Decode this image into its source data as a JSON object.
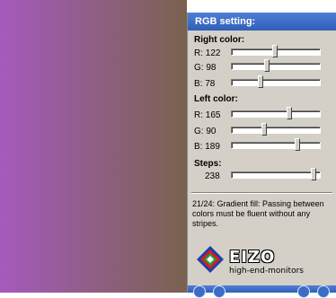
{
  "gradient": {
    "color_left": "#a55abd",
    "color_right": "#7a624e"
  },
  "panel": {
    "title": "RGB setting:",
    "right_color": {
      "label": "Right color:",
      "r": {
        "label": "R: 122",
        "value": 122
      },
      "g": {
        "label": "G: 98",
        "value": 98
      },
      "b": {
        "label": "B: 78",
        "value": 78
      }
    },
    "left_color": {
      "label": "Left color:",
      "r": {
        "label": "R: 165",
        "value": 165
      },
      "g": {
        "label": "G: 90",
        "value": 90
      },
      "b": {
        "label": "B: 189",
        "value": 189
      }
    },
    "steps": {
      "label": "Steps:",
      "value_text": "238",
      "value": 238,
      "max": 255
    },
    "description": "21/24: Gradient fill: Passing between colors must be fluent without any stripes.",
    "logo": {
      "brand": "EIZO",
      "tagline": "high-end-monitors"
    }
  }
}
